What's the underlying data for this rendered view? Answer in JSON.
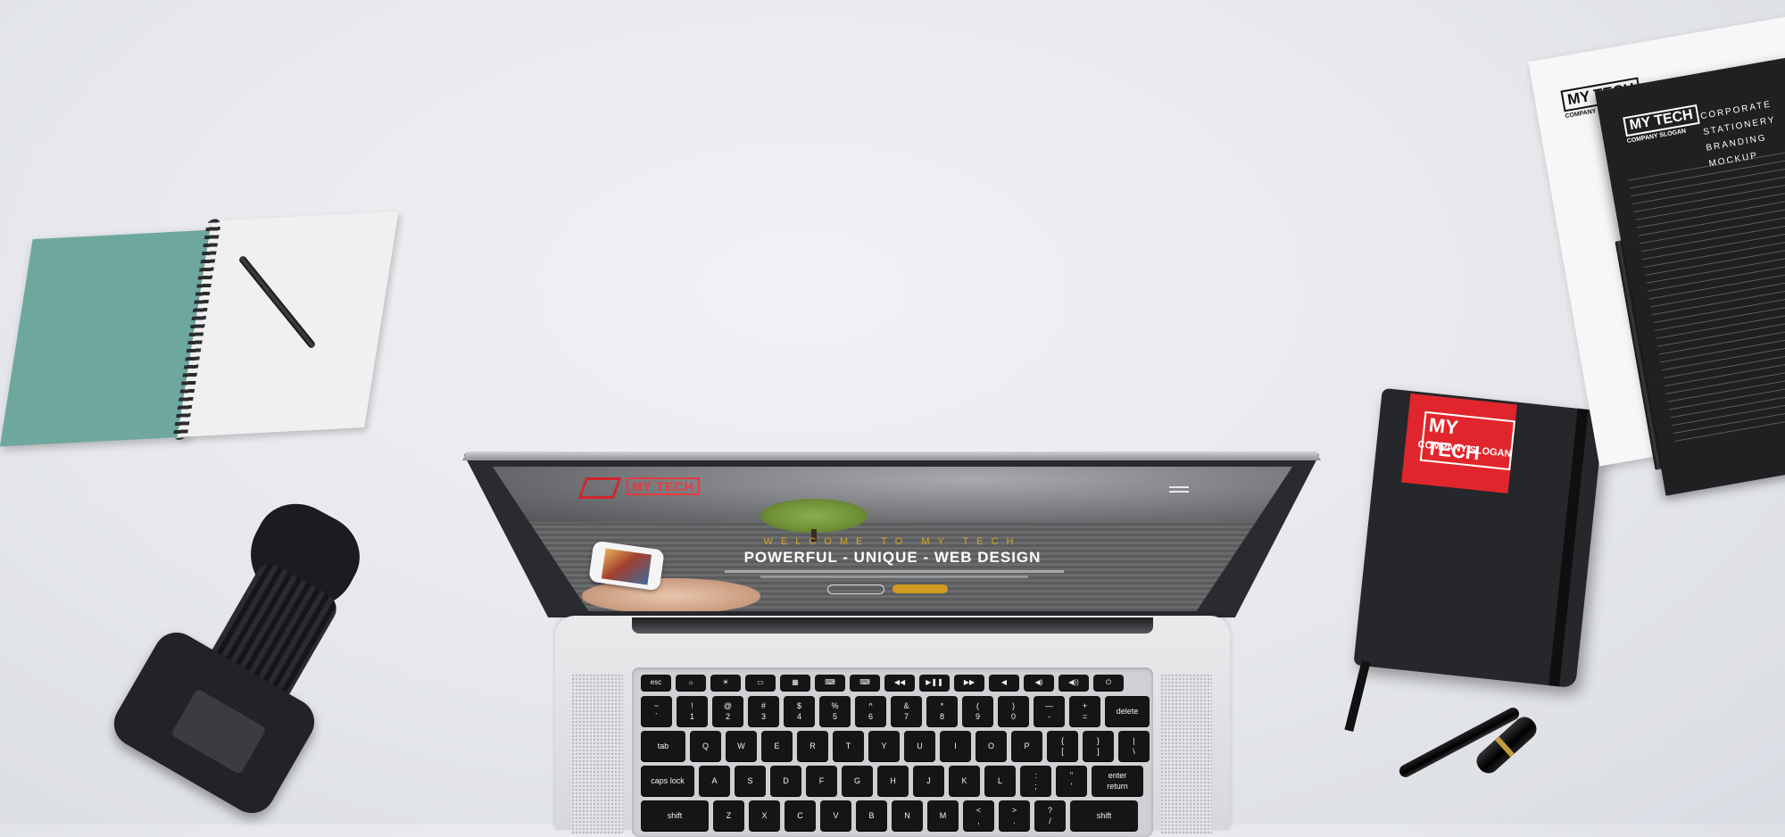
{
  "laptop_screen": {
    "logo_text": "MY TECH",
    "welcome_text": "WELCOME TO MY TECH",
    "headline": "POWERFUL - UNIQUE - WEB DESIGN"
  },
  "keyboard": {
    "function_row": [
      "esc",
      "☼",
      "☀",
      "▭",
      "▦",
      "⌨",
      "⌨",
      "◀◀",
      "▶❚❚",
      "▶▶",
      "◀",
      "◀)",
      "◀))",
      "⏻"
    ],
    "number_row": [
      "~\n`",
      "!\n1",
      "@\n2",
      "#\n3",
      "$\n4",
      "%\n5",
      "^\n6",
      "&\n7",
      "*\n8",
      "(\n9",
      ")\n0",
      "—\n-",
      "+\n=",
      "delete"
    ],
    "top_row": [
      "tab",
      "Q",
      "W",
      "E",
      "R",
      "T",
      "Y",
      "U",
      "I",
      "O",
      "P",
      "{\n[",
      "}\n]",
      "|\n\\"
    ],
    "home_row": [
      "caps lock",
      "A",
      "S",
      "D",
      "F",
      "G",
      "H",
      "J",
      "K",
      "L",
      ":\n;",
      "\"\n'",
      "enter\nreturn"
    ],
    "bottom_row": [
      "shift",
      "Z",
      "X",
      "C",
      "V",
      "B",
      "N",
      "M",
      "<\n,",
      ">\n.",
      "?\n/",
      "shift"
    ]
  },
  "black_notebook": {
    "brand": "MY TECH",
    "slogan": "COMPANY SLOGAN"
  },
  "stationery": {
    "white_sheet_brand": "MY TECH",
    "white_sheet_slogan": "COMPANY SLOGAN",
    "white_sheet_heading": "CORPORATE STATIONERY",
    "dark_sheet_brand": "MY TECH",
    "dark_sheet_slogan": "COMPANY SLOGAN",
    "dark_sheet_title": "CORPORATE STATIONERY BRANDING MOCKUP"
  },
  "colors": {
    "brand_red": "#e0262c",
    "accent_gold": "#d19a20",
    "notebook_teal": "#6ea79d"
  }
}
